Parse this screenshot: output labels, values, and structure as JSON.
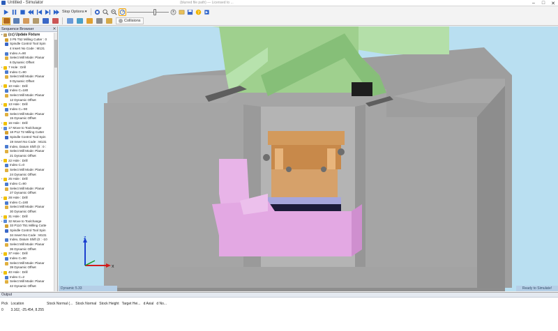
{
  "window": {
    "title": "Untitled - Simulator",
    "center_text": "(blurred file path) — Licensed to ..."
  },
  "toolbar": {
    "stop_options_label": "Stop Options",
    "collisions_label": "Collisions",
    "speed_slider_value": 0.68
  },
  "sequence_browser": {
    "title": "Sequence Browser",
    "items": [
      {
        "text": "(cc) Update Fixture",
        "level": 0,
        "icon": "fixture-icon",
        "bold": true
      },
      {
        "text": "3 P5 T52 Milling Cutter : 0",
        "level": 1,
        "icon": "tool-icon"
      },
      {
        "text": "Spindle Control Tool Spin",
        "level": 1,
        "icon": "spindle-icon"
      },
      {
        "text": "4 Insert No Code : M131",
        "level": 1,
        "icon": "none"
      },
      {
        "text": "Index A=90",
        "level": 1,
        "icon": "index-icon"
      },
      {
        "text": "Select Mill Mode: Planar",
        "level": 1,
        "icon": "mode-icon"
      },
      {
        "text": "6 Dynamic Offset",
        "level": 1,
        "icon": "none"
      },
      {
        "text": "7 Hole : Drill",
        "level": 0,
        "icon": "hole-icon"
      },
      {
        "text": "Index C=90",
        "level": 1,
        "icon": "index-icon"
      },
      {
        "text": "Select Mill Mode: Planar",
        "level": 1,
        "icon": "mode-icon"
      },
      {
        "text": "9 Dynamic Offset",
        "level": 1,
        "icon": "none"
      },
      {
        "text": "10 Hole : Drill",
        "level": 0,
        "icon": "hole-icon"
      },
      {
        "text": "Index C=180",
        "level": 1,
        "icon": "index-icon"
      },
      {
        "text": "Select Mill Mode: Planar",
        "level": 1,
        "icon": "mode-icon"
      },
      {
        "text": "12 Dynamic Offset",
        "level": 1,
        "icon": "none"
      },
      {
        "text": "13 Hole : Drill",
        "level": 0,
        "icon": "hole-icon"
      },
      {
        "text": "Index C=-90",
        "level": 1,
        "icon": "index-icon"
      },
      {
        "text": "Select Mill Mode: Planar",
        "level": 1,
        "icon": "mode-icon"
      },
      {
        "text": "15 Dynamic Offset",
        "level": 1,
        "icon": "none"
      },
      {
        "text": "16 Hole : Drill",
        "level": 0,
        "icon": "hole-icon"
      },
      {
        "text": "17 Move to Toolchange",
        "level": 0,
        "icon": "move-icon"
      },
      {
        "text": "18 P12 T2 Milling Cutter",
        "level": 1,
        "icon": "tool-icon"
      },
      {
        "text": "Spindle Control Tool Spin",
        "level": 1,
        "icon": "spindle-icon"
      },
      {
        "text": "19 Insert No Code : M131",
        "level": 1,
        "icon": "none"
      },
      {
        "text": "Index, Datum Shift (0 : 0 :",
        "level": 1,
        "icon": "index-icon"
      },
      {
        "text": "Select Mill Mode: Planar",
        "level": 1,
        "icon": "mode-icon"
      },
      {
        "text": "21 Dynamic Offset",
        "level": 1,
        "icon": "none"
      },
      {
        "text": "22 Hole : Drill",
        "level": 0,
        "icon": "hole-icon"
      },
      {
        "text": "Index C=0",
        "level": 1,
        "icon": "index-icon"
      },
      {
        "text": "Select Mill Mode: Planar",
        "level": 1,
        "icon": "mode-icon"
      },
      {
        "text": "24 Dynamic Offset",
        "level": 1,
        "icon": "none"
      },
      {
        "text": "25 Hole : Drill",
        "level": 0,
        "icon": "hole-icon"
      },
      {
        "text": "Index C=90",
        "level": 1,
        "icon": "index-icon"
      },
      {
        "text": "Select Mill Mode: Planar",
        "level": 1,
        "icon": "mode-icon"
      },
      {
        "text": "27 Dynamic Offset",
        "level": 1,
        "icon": "none"
      },
      {
        "text": "28 Hole : Drill",
        "level": 0,
        "icon": "hole-icon"
      },
      {
        "text": "Index C=180",
        "level": 1,
        "icon": "index-icon"
      },
      {
        "text": "Select Mill Mode: Planar",
        "level": 1,
        "icon": "mode-icon"
      },
      {
        "text": "30 Dynamic Offset",
        "level": 1,
        "icon": "none"
      },
      {
        "text": "31 Hole : Drill",
        "level": 0,
        "icon": "hole-icon"
      },
      {
        "text": "32 Move to Toolchange",
        "level": 0,
        "icon": "move-icon"
      },
      {
        "text": "33 P110 T51 Milling Cutte",
        "level": 1,
        "icon": "tool-icon"
      },
      {
        "text": "Spindle Control Tool Spin",
        "level": 1,
        "icon": "spindle-icon"
      },
      {
        "text": "34 Insert No Code : M131",
        "level": 1,
        "icon": "none"
      },
      {
        "text": "Index, Datum Shift (0 : -10",
        "level": 1,
        "icon": "index-icon"
      },
      {
        "text": "Select Mill Mode: Planar",
        "level": 1,
        "icon": "mode-icon"
      },
      {
        "text": "36 Dynamic Offset",
        "level": 1,
        "icon": "none"
      },
      {
        "text": "37 Hole : Drill",
        "level": 0,
        "icon": "hole-icon"
      },
      {
        "text": "Index C=90",
        "level": 1,
        "icon": "index-icon"
      },
      {
        "text": "Select Mill Mode: Planar",
        "level": 1,
        "icon": "mode-icon"
      },
      {
        "text": "39 Dynamic Offset",
        "level": 1,
        "icon": "none"
      },
      {
        "text": "40 Hole : Drill",
        "level": 0,
        "icon": "hole-icon"
      },
      {
        "text": "Index C=2",
        "level": 1,
        "icon": "index-icon"
      },
      {
        "text": "Select Mill Mode: Planar",
        "level": 1,
        "icon": "mode-icon"
      },
      {
        "text": "42 Dynamic Offset",
        "level": 1,
        "icon": "none"
      }
    ]
  },
  "viewport": {
    "status_left": "Dynamic 5.33",
    "status_right": "Ready to Simulate!",
    "axes": {
      "z": "z",
      "x": "x"
    }
  },
  "output": {
    "title": "Output",
    "columns": [
      "Pick",
      "Location",
      "Stock Normal (...",
      "Stock Normal",
      "Stock Height",
      "Target Hei...",
      "d Axial",
      "d No..."
    ],
    "rows": [
      [
        "0",
        "3.162, -25.454, 8.255",
        "",
        "",
        "",
        "",
        "",
        ""
      ]
    ]
  },
  "colors": {
    "viewport_bg": "#b9dff1",
    "machine_gray": "#a3a3a3",
    "head_green": "#a8d7a0",
    "table_pink": "#e3a8e3",
    "part_orange": "#d39a5c"
  }
}
